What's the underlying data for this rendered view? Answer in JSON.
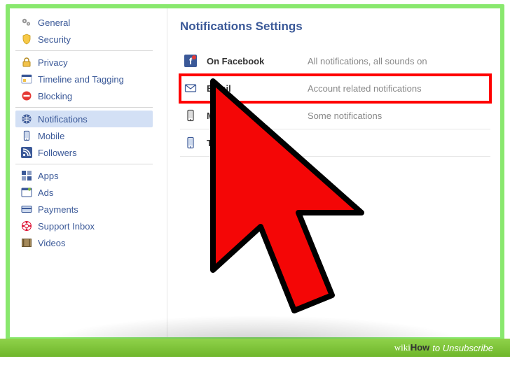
{
  "sidebar": {
    "group1": [
      {
        "icon": "gear",
        "label": "General"
      },
      {
        "icon": "shield",
        "label": "Security"
      }
    ],
    "group2": [
      {
        "icon": "lock",
        "label": "Privacy"
      },
      {
        "icon": "timeline",
        "label": "Timeline and Tagging"
      },
      {
        "icon": "block",
        "label": "Blocking"
      }
    ],
    "group3": [
      {
        "icon": "globe",
        "label": "Notifications",
        "active": true
      },
      {
        "icon": "mobile",
        "label": "Mobile"
      },
      {
        "icon": "rss",
        "label": "Followers"
      }
    ],
    "group4": [
      {
        "icon": "apps",
        "label": "Apps"
      },
      {
        "icon": "ads",
        "label": "Ads"
      },
      {
        "icon": "card",
        "label": "Payments"
      },
      {
        "icon": "life",
        "label": "Support Inbox"
      },
      {
        "icon": "film",
        "label": "Videos"
      }
    ]
  },
  "main": {
    "title": "Notifications Settings",
    "rows": [
      {
        "icon": "fb",
        "name": "On Facebook",
        "desc": "All notifications, all sounds on"
      },
      {
        "icon": "mail",
        "name": "Email",
        "desc": "Account related notifications",
        "highlight": true
      },
      {
        "icon": "mobile2",
        "name": "Mobile",
        "desc": "Some notifications"
      },
      {
        "icon": "sms",
        "name": "Text message",
        "desc": ""
      }
    ]
  },
  "footer": {
    "brand1": "wiki",
    "brand2": "How",
    "article": " to Unsubscribe"
  }
}
